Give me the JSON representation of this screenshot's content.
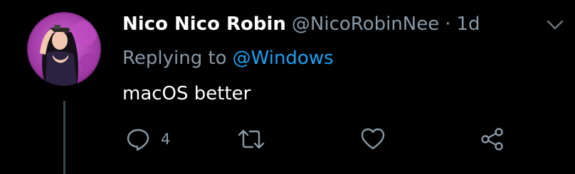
{
  "tweet": {
    "display_name": "Nico Nico Robin",
    "handle": "@NicoRobinNee",
    "separator": "·",
    "time": "1d",
    "reply_prefix": "Replying to",
    "reply_mention": "@Windows",
    "text": "macOS better"
  },
  "actions": {
    "reply_count": "4"
  },
  "icons": {
    "caret": "chevron-down-icon",
    "reply": "comment-icon",
    "retweet": "retweet-icon",
    "like": "heart-icon",
    "share": "share-icon"
  },
  "colors": {
    "background": "#000000",
    "text": "#ffffff",
    "muted": "#8899a6",
    "link": "#1da1f2",
    "avatar_bg": "#b23fb5"
  }
}
